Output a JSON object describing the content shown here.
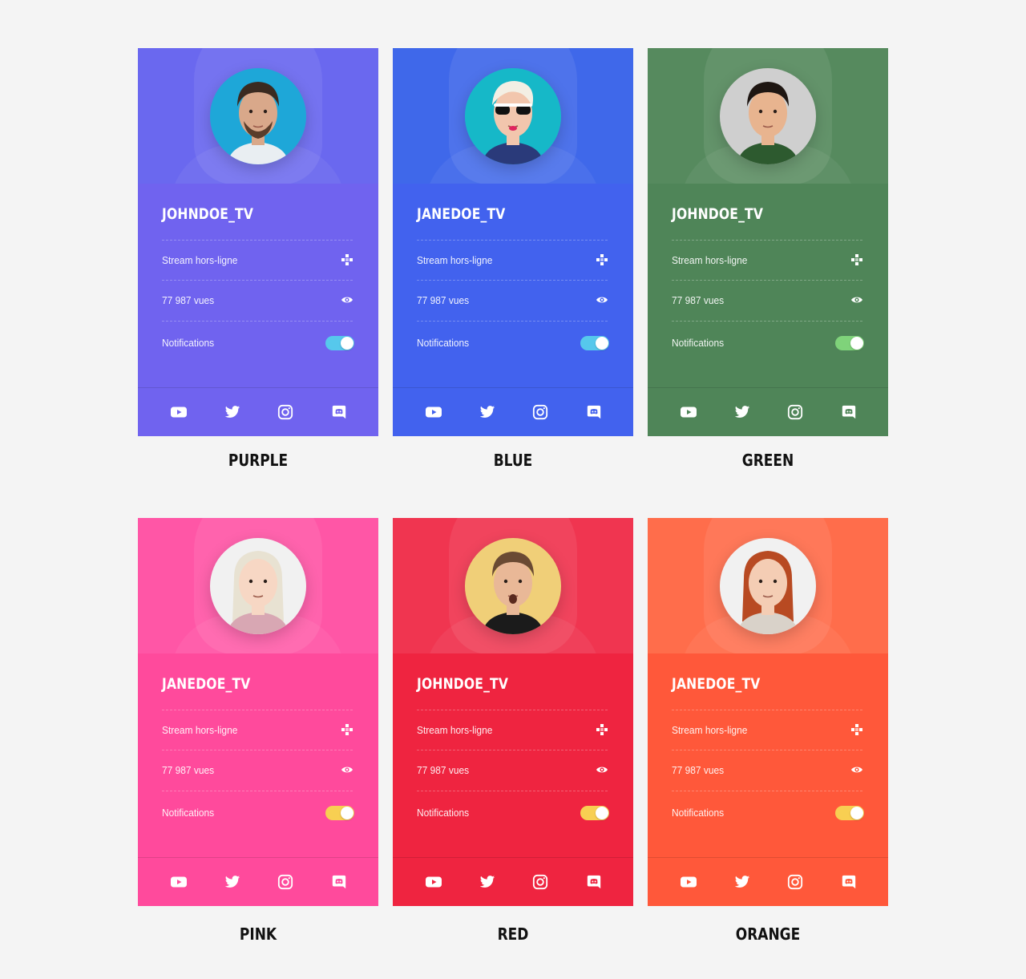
{
  "cards": [
    {
      "username": "JOHNDOE_TV",
      "stream_status": "Stream hors-ligne",
      "views": "77 987 vues",
      "notifications_label": "Notifications",
      "notifications_on": true,
      "caption": "PURPLE",
      "colors": {
        "hero": "#6a68ee",
        "body": "#7063ef",
        "footer": "#7063ef",
        "toggle": "#56c8ec",
        "avatar_bg": "#1ea7d8"
      }
    },
    {
      "username": "JANEDOE_TV",
      "stream_status": "Stream hors-ligne",
      "views": "77 987 vues",
      "notifications_label": "Notifications",
      "notifications_on": true,
      "caption": "BLUE",
      "colors": {
        "hero": "#3f68ea",
        "body": "#4262ee",
        "footer": "#4262ee",
        "toggle": "#56c8ec",
        "avatar_bg": "#16b8c8"
      }
    },
    {
      "username": "JOHNDOE_TV",
      "stream_status": "Stream hors-ligne",
      "views": "77 987 vues",
      "notifications_label": "Notifications",
      "notifications_on": true,
      "caption": "GREEN",
      "colors": {
        "hero": "#578a5e",
        "body": "#4f8558",
        "footer": "#4f8558",
        "toggle": "#7fd37a",
        "avatar_bg": "#cfcfcf"
      }
    },
    {
      "username": "JANEDOE_TV",
      "stream_status": "Stream hors-ligne",
      "views": "77 987 vues",
      "notifications_label": "Notifications",
      "notifications_on": true,
      "caption": "PINK",
      "colors": {
        "hero": "#ff57a6",
        "body": "#ff4a9c",
        "footer": "#ff4a9c",
        "toggle": "#f8cf52",
        "avatar_bg": "#f1f1f1"
      }
    },
    {
      "username": "JOHNDOE_TV",
      "stream_status": "Stream hors-ligne",
      "views": "77 987 vues",
      "notifications_label": "Notifications",
      "notifications_on": true,
      "caption": "RED",
      "colors": {
        "hero": "#ef3550",
        "body": "#ef2440",
        "footer": "#ef2440",
        "toggle": "#f8cf52",
        "avatar_bg": "#f0cf78"
      }
    },
    {
      "username": "JANEDOE_TV",
      "stream_status": "Stream hors-ligne",
      "views": "77 987 vues",
      "notifications_label": "Notifications",
      "notifications_on": true,
      "caption": "ORANGE",
      "colors": {
        "hero": "#ff6d4b",
        "body": "#ff583a",
        "footer": "#ff583a",
        "toggle": "#f8cf52",
        "avatar_bg": "#f1f1f1"
      }
    }
  ],
  "icons": {
    "stream": "gamepad-icon",
    "views": "eye-icon",
    "social": [
      "youtube-icon",
      "twitter-icon",
      "instagram-icon",
      "discord-icon"
    ]
  }
}
